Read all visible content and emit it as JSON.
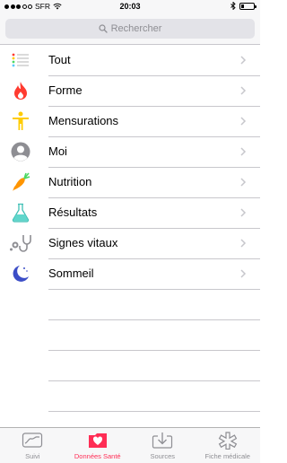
{
  "status_bar": {
    "carrier": "SFR",
    "time": "20:03"
  },
  "search": {
    "placeholder": "Rechercher"
  },
  "categories": [
    {
      "label": "Tout",
      "icon": "list-icon"
    },
    {
      "label": "Forme",
      "icon": "flame-icon"
    },
    {
      "label": "Mensurations",
      "icon": "body-figure-icon"
    },
    {
      "label": "Moi",
      "icon": "person-icon"
    },
    {
      "label": "Nutrition",
      "icon": "carrot-icon"
    },
    {
      "label": "Résultats",
      "icon": "flask-icon"
    },
    {
      "label": "Signes vitaux",
      "icon": "stethoscope-icon"
    },
    {
      "label": "Sommeil",
      "icon": "moon-icon"
    }
  ],
  "tabs": [
    {
      "label": "Suivi",
      "icon": "chart-icon",
      "active": false
    },
    {
      "label": "Données Santé",
      "icon": "health-folder-icon",
      "active": true
    },
    {
      "label": "Sources",
      "icon": "download-icon",
      "active": false
    },
    {
      "label": "Fiche médicale",
      "icon": "medical-star-icon",
      "active": false
    }
  ],
  "colors": {
    "accent": "#ff2d55",
    "chevron": "#c7c7cc",
    "separator": "#c8c7cc",
    "bar_background": "#f7f7f8",
    "inactive_tab": "#8e8e93"
  }
}
